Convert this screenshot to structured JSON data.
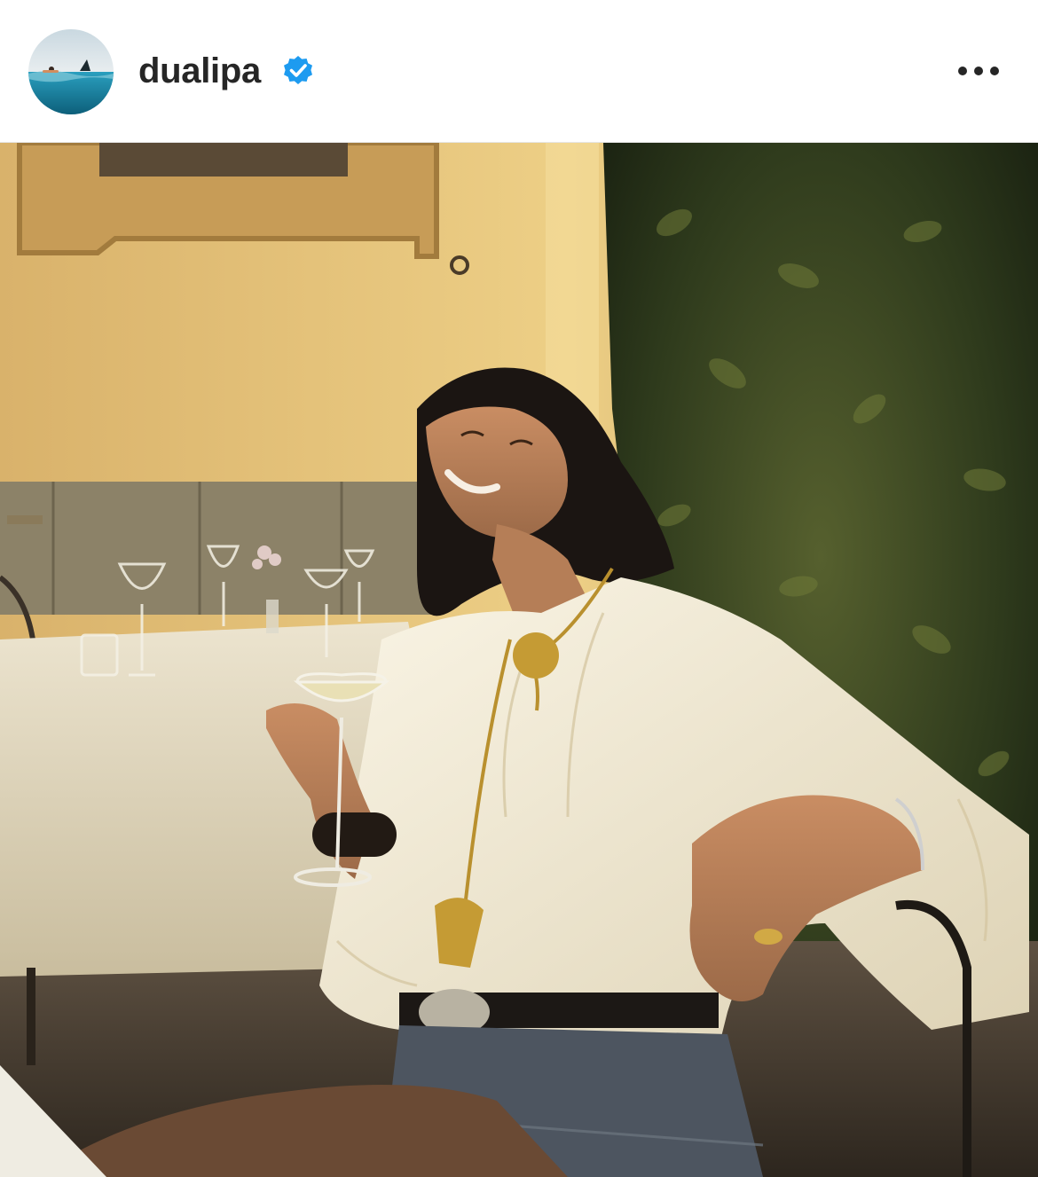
{
  "post": {
    "username": "dualipa",
    "verified": true,
    "more_label": "More options",
    "photo_alt": ""
  },
  "colors": {
    "text": "#262626",
    "verified_badge": "#1d9bf0",
    "wall": "#e8c47a",
    "foliage": "#2f3a1e"
  },
  "icons": [
    "verified-badge-icon",
    "more-options-icon"
  ]
}
